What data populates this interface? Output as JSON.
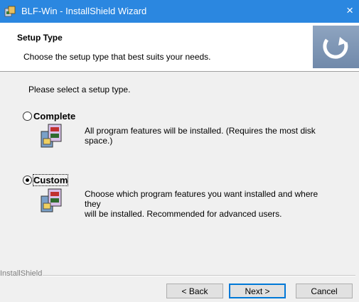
{
  "window": {
    "title": "BLF-Win - InstallShield Wizard",
    "close_glyph": "×"
  },
  "header": {
    "title": "Setup Type",
    "subtitle": "Choose the setup type that best suits your needs."
  },
  "main": {
    "prompt": "Please select a setup type.",
    "options": [
      {
        "label": "Complete",
        "selected": false,
        "description_line1": "All program features will be installed. (Requires the most disk",
        "description_line2": "space.)"
      },
      {
        "label": "Custom",
        "selected": true,
        "description_line1": "Choose which program features you want installed and where they",
        "description_line2": "will be installed. Recommended for advanced users."
      }
    ]
  },
  "footer": {
    "brand": "InstallShield",
    "back_label": "< Back",
    "next_label": "Next >",
    "cancel_label": "Cancel"
  },
  "icons": [
    "installer-icon",
    "setup-logo-icon",
    "package-icon",
    "radio-icon"
  ],
  "colors": {
    "titlebar": "#2b87e0",
    "content_bg": "#f0f0f0",
    "default_button_border": "#0078d7"
  }
}
